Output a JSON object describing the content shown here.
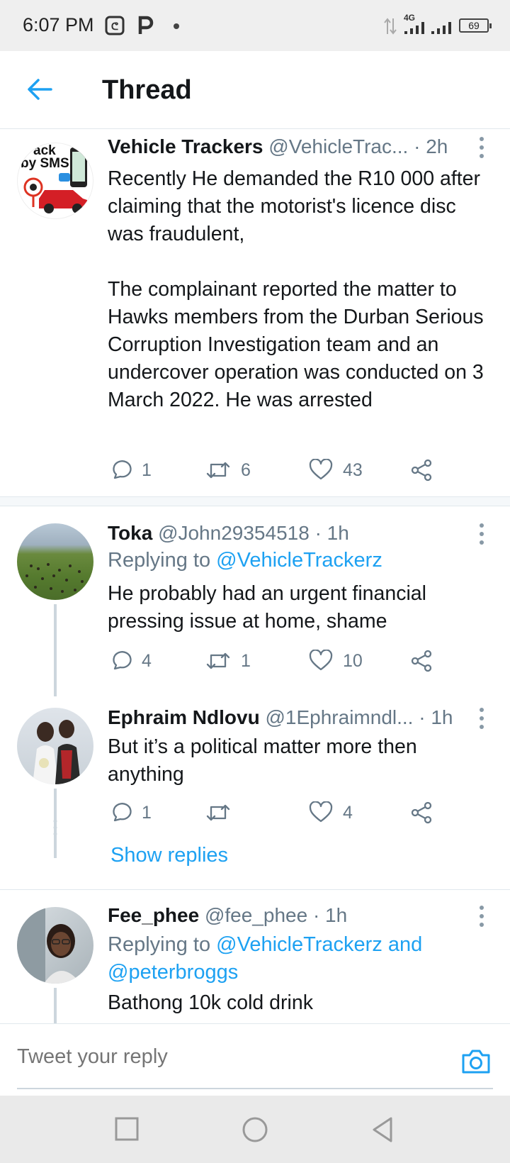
{
  "status": {
    "time": "6:07 PM",
    "network": "4G",
    "battery": "69"
  },
  "header": {
    "title": "Thread"
  },
  "tweets": [
    {
      "name": "Vehicle Trackers",
      "handle": "@VehicleTrac...",
      "time": "· 2h",
      "avatar_text_1": "ack",
      "avatar_text_2": "by SMS",
      "body_1": "Recently He demanded the R10 000 after claiming that the motorist's licence disc was fraudulent,",
      "body_2": "The complainant reported the matter to Hawks members from the Durban Serious Corruption Investigation team and an undercover operation was conducted on 3 March 2022. He was arrested",
      "replies": "1",
      "retweets": "6",
      "likes": "43"
    },
    {
      "name": "Toka",
      "handle": "@John29354518",
      "time": "· 1h",
      "replying_prefix": "Replying to ",
      "replying_to": "@VehicleTrackerz",
      "body": "He probably had an urgent financial pressing issue at home, shame",
      "replies": "4",
      "retweets": "1",
      "likes": "10"
    },
    {
      "name": "Ephraim Ndlovu",
      "handle": "@1Ephraimndl...",
      "time": "· 1h",
      "body": "But it’s a political matter more then anything",
      "replies": "1",
      "retweets": "",
      "likes": "4"
    },
    {
      "name": "Fee_phee",
      "handle": "@fee_phee",
      "time": "· 1h",
      "replying_prefix": "Replying to ",
      "replying_to": "@VehicleTrackerz and @peterbroggs",
      "body": "Bathong 10k cold drink"
    }
  ],
  "show_replies": "Show replies",
  "reply_bar": {
    "placeholder": "Tweet your reply"
  },
  "colors": {
    "accent": "#1da1f2",
    "muted": "#657786",
    "text": "#14171a"
  },
  "icons": {
    "back": "arrow-left-icon",
    "more": "more-vertical-icon",
    "reply": "comment-icon",
    "retweet": "retweet-icon",
    "like": "heart-icon",
    "share": "share-icon",
    "camera": "camera-icon",
    "nav_recents": "square-icon",
    "nav_home": "circle-icon",
    "nav_back": "triangle-back-icon"
  }
}
